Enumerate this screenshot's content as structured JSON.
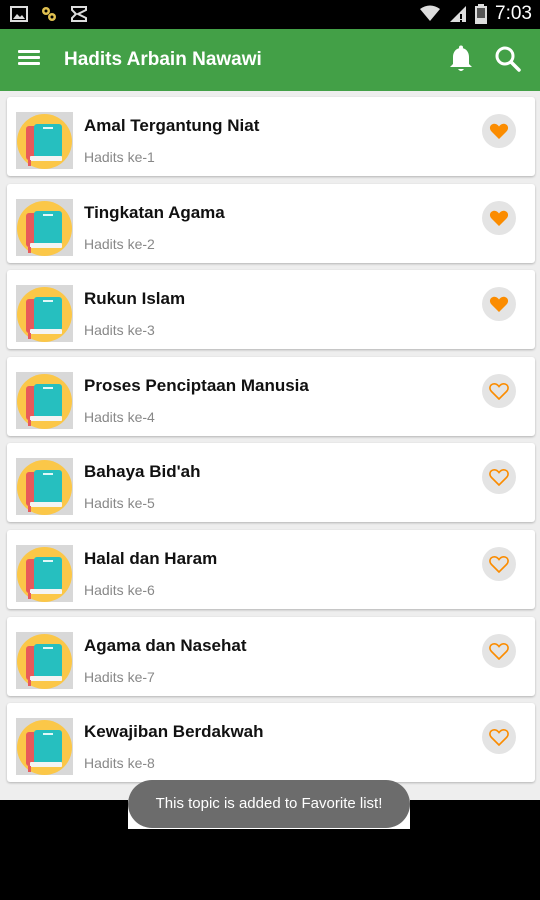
{
  "status_bar": {
    "time": "7:03",
    "icons": [
      "image-notification-icon",
      "settings-notification-icon",
      "app-notification-icon",
      "wifi-icon",
      "signal-icon",
      "battery-icon"
    ]
  },
  "app_bar": {
    "title": "Hadits Arbain Nawawi",
    "icons": [
      "menu-icon",
      "bell-icon",
      "search-icon"
    ]
  },
  "colors": {
    "primary": "#43a047",
    "accent": "#fb8c00",
    "thumb_circle": "#fbc748"
  },
  "hadith_list": [
    {
      "title": "Amal Tergantung Niat",
      "subtitle": "Hadits ke-1",
      "favorite": true
    },
    {
      "title": "Tingkatan Agama",
      "subtitle": "Hadits ke-2",
      "favorite": true
    },
    {
      "title": "Rukun Islam",
      "subtitle": "Hadits ke-3",
      "favorite": true
    },
    {
      "title": "Proses Penciptaan Manusia",
      "subtitle": "Hadits ke-4",
      "favorite": false
    },
    {
      "title": "Bahaya Bid'ah",
      "subtitle": "Hadits ke-5",
      "favorite": false
    },
    {
      "title": "Halal dan Haram",
      "subtitle": "Hadits ke-6",
      "favorite": false
    },
    {
      "title": "Agama dan Nasehat",
      "subtitle": "Hadits ke-7",
      "favorite": false
    },
    {
      "title": "Kewajiban Berdakwah",
      "subtitle": "Hadits ke-8",
      "favorite": false
    }
  ],
  "toast": {
    "message": "This topic is added to Favorite list!"
  }
}
